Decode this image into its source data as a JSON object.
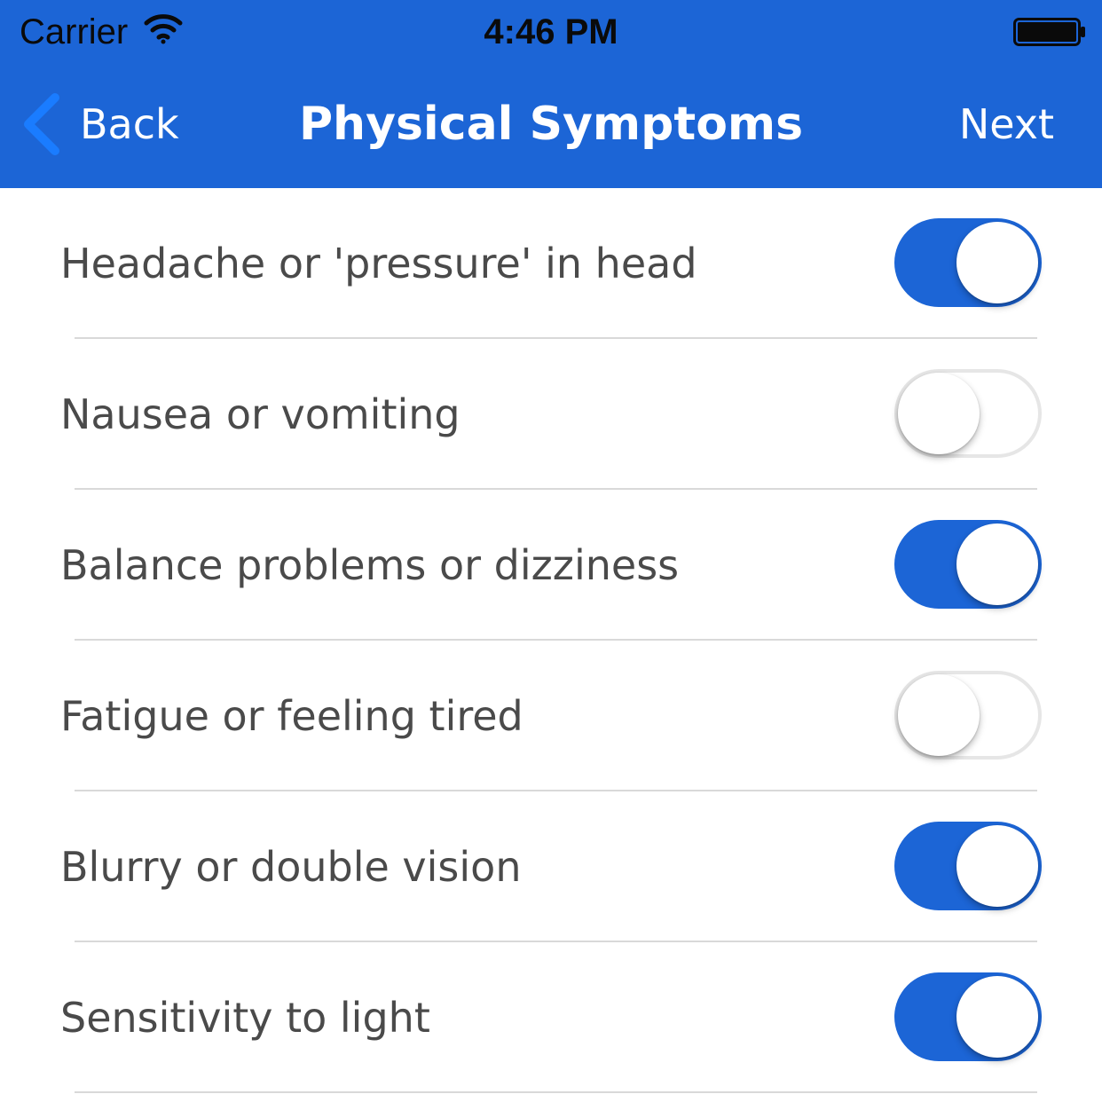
{
  "status_bar": {
    "carrier": "Carrier",
    "time": "4:46 PM",
    "wifi_icon": "wifi-icon",
    "battery_icon": "battery-icon"
  },
  "nav": {
    "back_label": "Back",
    "title": "Physical Symptoms",
    "next_label": "Next",
    "back_icon": "chevron-left-icon"
  },
  "colors": {
    "accent": "#1c65d6",
    "label_text": "#4a4a4a",
    "divider": "#d9d9d9"
  },
  "symptoms": [
    {
      "label": "Headache or 'pressure' in head",
      "enabled": true
    },
    {
      "label": "Nausea or vomiting",
      "enabled": false
    },
    {
      "label": "Balance problems or dizziness",
      "enabled": true
    },
    {
      "label": "Fatigue or feeling tired",
      "enabled": false
    },
    {
      "label": "Blurry or double vision",
      "enabled": true
    },
    {
      "label": "Sensitivity to light",
      "enabled": true
    }
  ]
}
